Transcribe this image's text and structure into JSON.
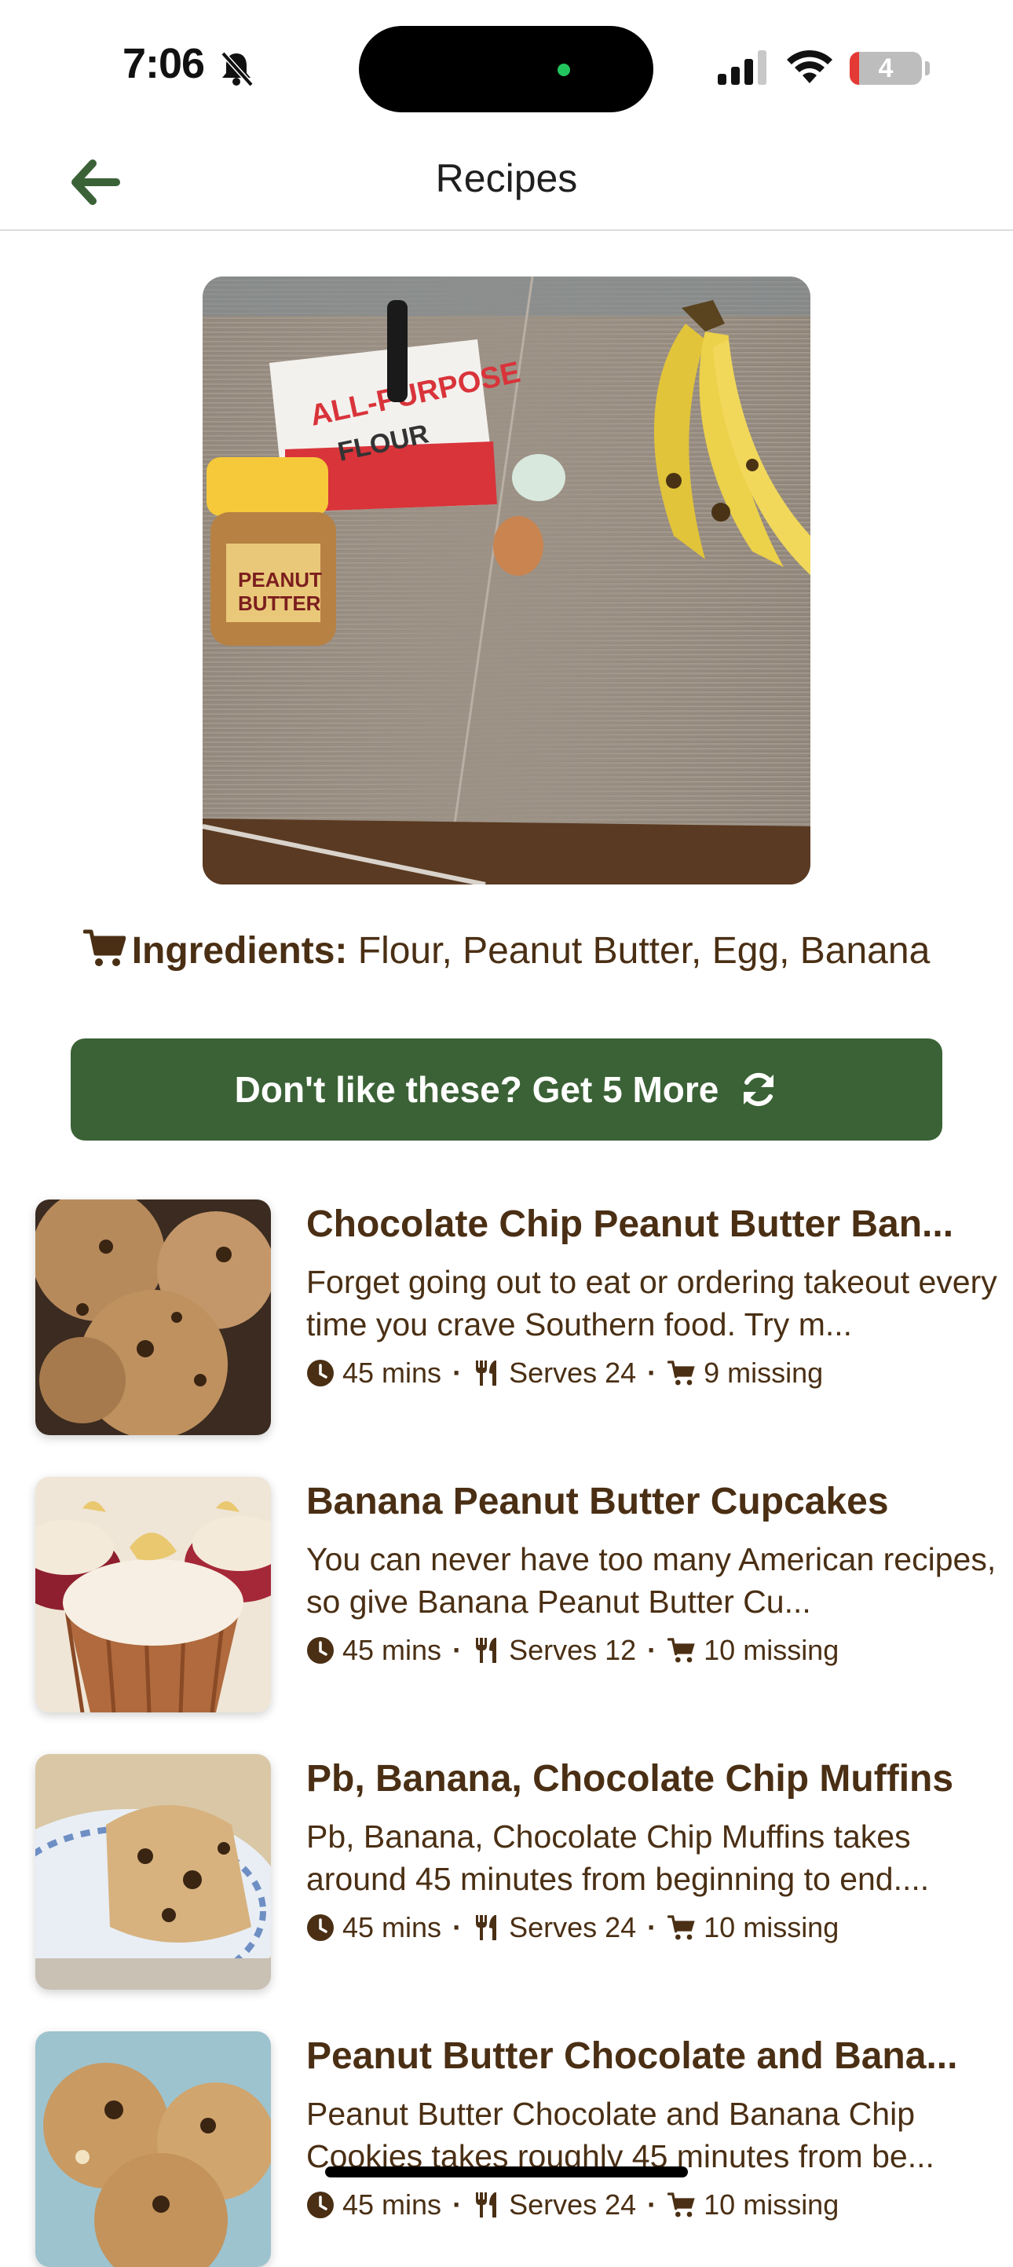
{
  "status_bar": {
    "time": "7:06",
    "battery": "4"
  },
  "nav": {
    "title": "Recipes"
  },
  "ingredients": {
    "label": "Ingredients:",
    "items": "Flour, Peanut Butter, Egg, Banana"
  },
  "cta": {
    "label": "Don't like these? Get 5 More"
  },
  "recipes": [
    {
      "title": "Chocolate Chip Peanut Butter Ban...",
      "description": "Forget going out to eat or ordering takeout every time you crave Southern food. Try m...",
      "time": "45 mins",
      "serves": "Serves 24",
      "missing": "9 missing"
    },
    {
      "title": "Banana Peanut Butter Cupcakes",
      "description": "You can never have too many American recipes, so give Banana Peanut Butter Cu...",
      "time": "45 mins",
      "serves": "Serves 12",
      "missing": "10 missing"
    },
    {
      "title": "Pb, Banana, Chocolate Chip Muffins",
      "description": "Pb, Banana, Chocolate Chip Muffins takes around 45 minutes from beginning to end....",
      "time": "45 mins",
      "serves": "Serves 24",
      "missing": "10 missing"
    },
    {
      "title": "Peanut Butter Chocolate and Bana...",
      "description": "Peanut Butter Chocolate and Banana Chip Cookies takes roughly 45 minutes from be...",
      "time": "45 mins",
      "serves": "Serves 24",
      "missing": "10 missing"
    }
  ],
  "colors": {
    "accent": "#3b6236",
    "text_brown": "#4a2f14",
    "battery_low": "#e53935"
  },
  "icons": [
    "back-arrow-icon",
    "cart-icon",
    "refresh-icon",
    "clock-icon",
    "utensils-icon",
    "bell-slash-icon",
    "signal-icon",
    "wifi-icon",
    "battery-icon"
  ]
}
